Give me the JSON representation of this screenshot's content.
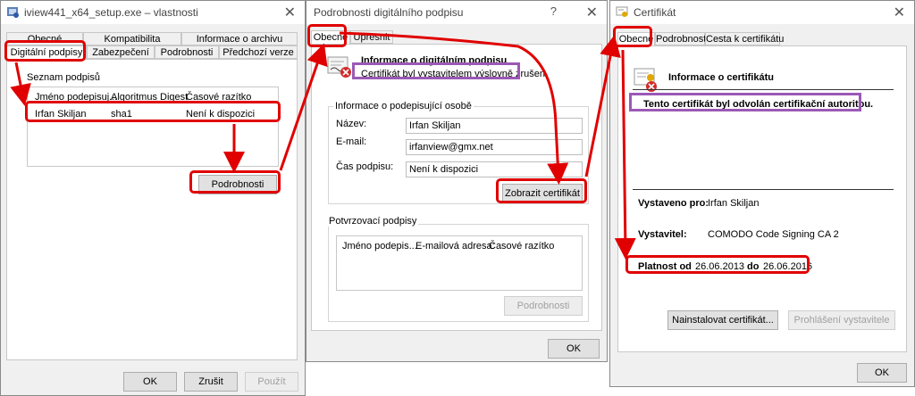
{
  "win1": {
    "title": "iview441_x64_setup.exe – vlastnosti",
    "tabs_row1": [
      "Obecné",
      "Kompatibilita",
      "Informace o archivu"
    ],
    "tabs_row2": [
      "Digitální podpisy",
      "Zabezpečení",
      "Podrobnosti",
      "Předchozí verze"
    ],
    "list_label": "Seznam podpisů",
    "columns": [
      "Jméno podepisuj...",
      "Algoritmus Digest",
      "Časové razítko"
    ],
    "row": [
      "Irfan Skiljan",
      "sha1",
      "Není k dispozici"
    ],
    "details_button": "Podrobnosti",
    "ok": "OK",
    "cancel": "Zrušit",
    "apply": "Použít"
  },
  "win2": {
    "title": "Podrobnosti digitálního podpisu",
    "help": "?",
    "tab": "Obecné",
    "tab_partial": "Upřesnit",
    "info_title": "Informace o digitálním podpisu",
    "info_status": "Certifikát byl vystavitelem výslovně zrušen.",
    "signer_group": "Informace o podepisující osobě",
    "name_label": "Název:",
    "name_value": "Irfan Skiljan",
    "email_label": "E-mail:",
    "email_value": "irfanview@gmx.net",
    "time_label": "Čas podpisu:",
    "time_value": "Není k dispozici",
    "view_cert_button": "Zobrazit certifikát",
    "countersign_group": "Potvrzovací podpisy",
    "cs_columns": [
      "Jméno podepis...",
      "E-mailová adresa:",
      "Časové razítko"
    ],
    "cs_details_button": "Podrobnosti",
    "ok": "OK"
  },
  "win3": {
    "title": "Certifikát",
    "tabs": [
      "Obecné",
      "Podrobnosti",
      "Cesta k certifikátu"
    ],
    "info_title": "Informace o certifikátu",
    "revoked_text": "Tento certifikát byl odvolán certifikační autoritou.",
    "issued_to_label": "Vystaveno pro:",
    "issued_to_value": "Irfan Skiljan",
    "issuer_label": "Vystavitel:",
    "issuer_value": "COMODO Code Signing CA 2",
    "validity_label": "Platnost od",
    "validity_from": "26.06.2013",
    "validity_to_label": "do",
    "validity_to": "26.06.2016",
    "install_button": "Nainstalovat certifikát...",
    "issuer_statement_button": "Prohlášení vystavitele",
    "ok": "OK"
  },
  "annotation_colors": {
    "red": "#e00000",
    "purple": "#9b59b6"
  }
}
